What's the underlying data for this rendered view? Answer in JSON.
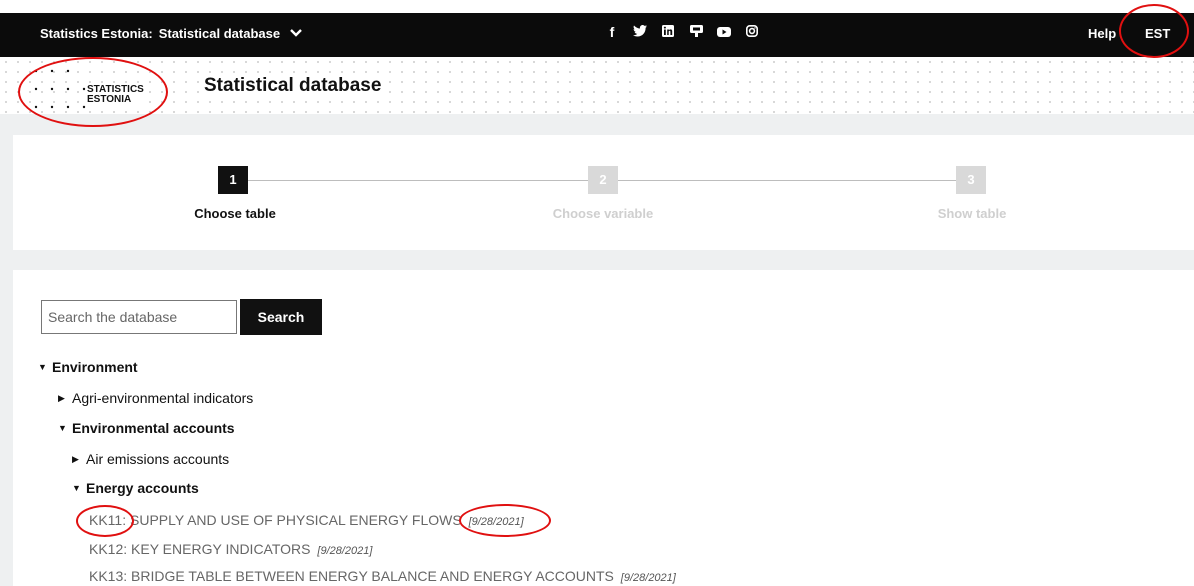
{
  "topbar": {
    "brand_prefix": "Statistics Estonia:",
    "brand_app": "Statistical database",
    "brand_chevron": "⌄",
    "socials": [
      {
        "icon": "facebook-icon",
        "glyph": "f"
      },
      {
        "icon": "twitter-icon",
        "glyph": "🐦"
      },
      {
        "icon": "linkedin-icon",
        "glyph": "in"
      },
      {
        "icon": "flickr-icon",
        "glyph": "▣"
      },
      {
        "icon": "youtube-icon",
        "glyph": "▶"
      },
      {
        "icon": "instagram-icon",
        "glyph": "◎"
      }
    ],
    "help_label": "Help",
    "lang_label": "EST"
  },
  "header": {
    "logo_line1": "STATISTICS",
    "logo_line2": "ESTONIA",
    "page_title": "Statistical database"
  },
  "steps": [
    {
      "number": "1",
      "label": "Choose table",
      "active": true
    },
    {
      "number": "2",
      "label": "Choose variable",
      "active": false
    },
    {
      "number": "3",
      "label": "Show table",
      "active": false
    }
  ],
  "search": {
    "placeholder": "Search the database",
    "button_label": "Search"
  },
  "tree": {
    "environment": "Environment",
    "agri": "Agri-environmental indicators",
    "env_accounts": "Environmental accounts",
    "air": "Air emissions accounts",
    "energy": "Energy accounts"
  },
  "tables": [
    {
      "code": "KK11:",
      "title": "SUPPLY AND USE OF PHYSICAL ENERGY FLOWS",
      "date": "[9/28/2021]"
    },
    {
      "code": "KK12:",
      "title": "KEY ENERGY INDICATORS",
      "date": "[9/28/2021]"
    },
    {
      "code": "KK13:",
      "title": "BRIDGE TABLE BETWEEN ENERGY BALANCE AND ENERGY ACCOUNTS",
      "date": "[9/28/2021]"
    }
  ],
  "colors": {
    "topbar": "#0b0b0b",
    "annotation": "#e01010",
    "panel_bg": "#eef0f1"
  }
}
